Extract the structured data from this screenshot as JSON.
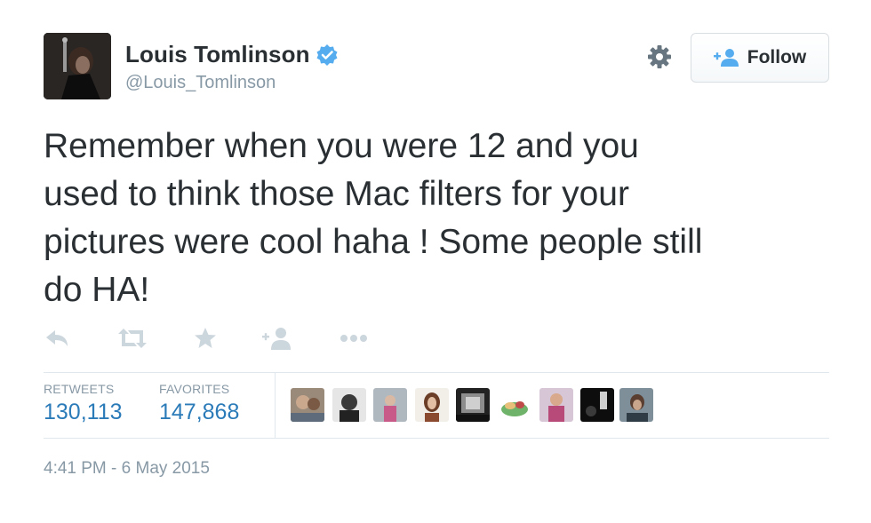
{
  "user": {
    "name": "Louis Tomlinson",
    "handle": "@Louis_Tomlinson",
    "verified": true
  },
  "follow_button": {
    "label": "Follow"
  },
  "tweet": {
    "lines": [
      "Remember when you were 12 and you",
      "used to think those Mac filters for your",
      "pictures were cool haha ! Some people still",
      "do HA!"
    ]
  },
  "actions": [
    "reply-icon",
    "retweet-icon",
    "favorite-icon",
    "follow-icon",
    "more-icon"
  ],
  "stats": {
    "retweets_label": "RETWEETS",
    "retweets_value": "130,113",
    "favorites_label": "FAVORITES",
    "favorites_value": "147,868"
  },
  "favoriters_count_shown": 9,
  "timestamp": "4:41 PM - 6 May 2015",
  "colors": {
    "link": "#2b7bb9",
    "verified": "#55acee",
    "muted": "#8899a6",
    "action_icon": "#ccd6dd",
    "text": "#292f33"
  }
}
